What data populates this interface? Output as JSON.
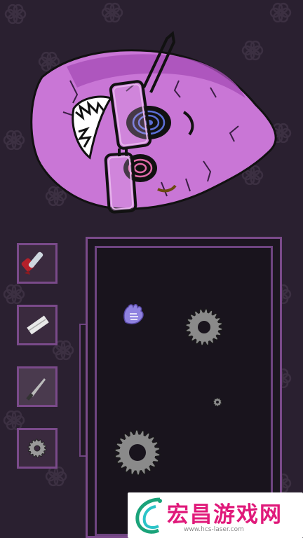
{
  "colors": {
    "background": "#2a2030",
    "frame": "#7a4a8a",
    "face": "#c976d6",
    "board": "#19141d",
    "gear": "#8a8a8a",
    "banner_title": "#e0197a"
  },
  "inventory": [
    {
      "name": "chainsaw-icon"
    },
    {
      "name": "blade-icon"
    },
    {
      "name": "knife-icon"
    },
    {
      "name": "gear-icon"
    }
  ],
  "board_items": [
    {
      "name": "purple-glove-icon"
    },
    {
      "name": "large-gear-icon"
    },
    {
      "name": "small-gear-icon"
    },
    {
      "name": "medium-gear-icon"
    }
  ],
  "watermark": {
    "title": "宏昌游戏网",
    "url": "www.hcs-laser.com"
  }
}
